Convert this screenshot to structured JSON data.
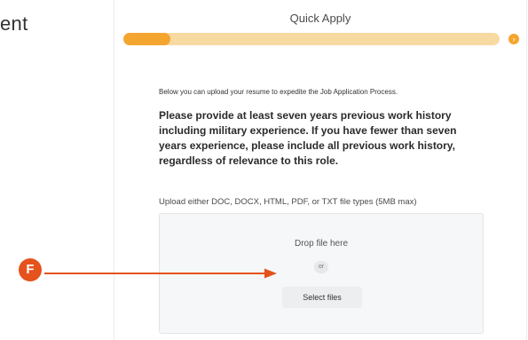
{
  "background_heading": {
    "text": "ent"
  },
  "dialog": {
    "title": "Quick Apply",
    "progress_fraction": 0.125,
    "progress_step_icon": "chevron-right-icon",
    "intro": "Below you can upload your resume to expedite the Job Application Process.",
    "instructions": "Please provide at least seven years previous work history including military experience.  If you have fewer than seven years experience, please include all previous work history, regardless of relevance to this role.",
    "upload_label": "Upload either DOC, DOCX, HTML, PDF, or TXT file types (5MB max)",
    "dropzone": {
      "drop_text": "Drop file here",
      "or_text": "or",
      "select_files_label": "Select files"
    }
  },
  "annotation": {
    "badge_letter": "F",
    "color": "#e5521c"
  },
  "colors": {
    "progress_track": "#f7d9a2",
    "progress_fill": "#f4a52f"
  }
}
